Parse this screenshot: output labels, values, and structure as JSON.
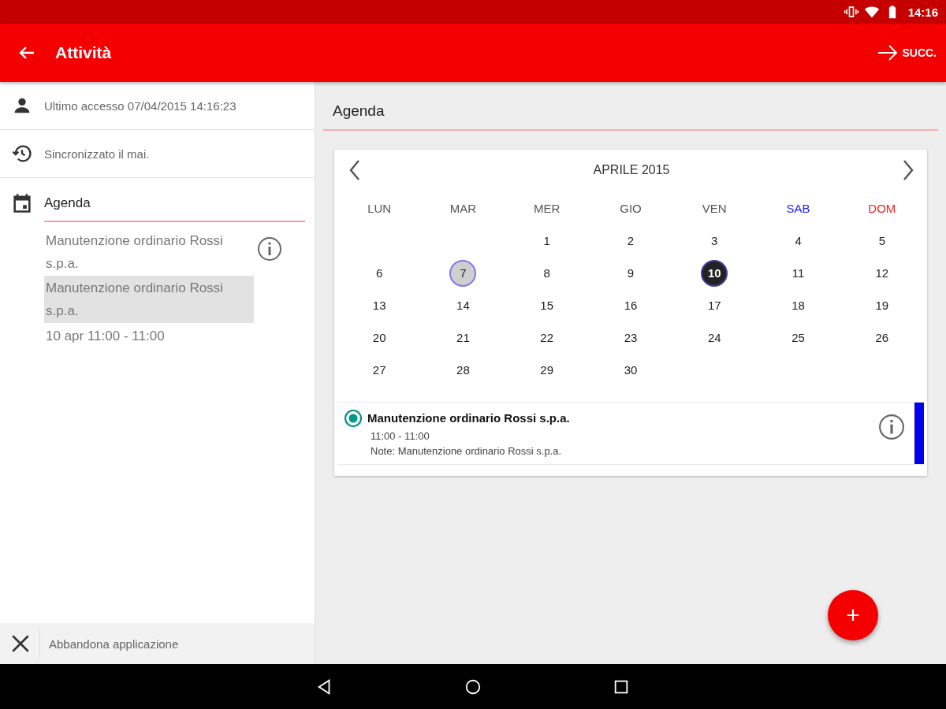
{
  "status_bar": {
    "time": "14:16"
  },
  "app_bar": {
    "title": "Attività",
    "next_label": "SUCC."
  },
  "sidebar": {
    "last_access": "Ultimo accesso 07/04/2015 14:16:23",
    "sync": "Sincronizzato il mai.",
    "agenda_title": "Agenda",
    "events": [
      {
        "title": "Manutenzione ordinario Rossi s.p.a.",
        "selected": false
      },
      {
        "title": "Manutenzione ordinario Rossi s.p.a.",
        "selected": true
      }
    ],
    "event_time": "10 apr 11:00 - 11:00",
    "exit_label": "Abbandona applicazione"
  },
  "main": {
    "title": "Agenda",
    "calendar": {
      "month": "APRILE 2015",
      "weekdays": [
        {
          "label": "LUN",
          "color": "#555555"
        },
        {
          "label": "MAR",
          "color": "#555555"
        },
        {
          "label": "MER",
          "color": "#555555"
        },
        {
          "label": "GIO",
          "color": "#555555"
        },
        {
          "label": "VEN",
          "color": "#555555"
        },
        {
          "label": "SAB",
          "color": "#2222ee"
        },
        {
          "label": "DOM",
          "color": "#ee2222"
        }
      ],
      "weeks": [
        {
          "kind": "partial_start",
          "days": [
            {
              "label": "1",
              "selected": false,
              "today": false
            },
            {
              "label": "2",
              "selected": false,
              "today": false
            },
            {
              "label": "3",
              "selected": false,
              "today": false
            },
            {
              "label": "4",
              "selected": false,
              "today": false
            },
            {
              "label": "5",
              "selected": false,
              "today": false
            }
          ]
        },
        {
          "kind": "full",
          "days": [
            {
              "label": "6",
              "selected": false,
              "today": false
            },
            {
              "label": "7",
              "selected": false,
              "today": true
            },
            {
              "label": "8",
              "selected": false,
              "today": false
            },
            {
              "label": "9",
              "selected": false,
              "today": false
            },
            {
              "label": "10",
              "selected": true,
              "today": false
            },
            {
              "label": "11",
              "selected": false,
              "today": false
            },
            {
              "label": "12",
              "selected": false,
              "today": false
            }
          ]
        },
        {
          "kind": "full",
          "days": [
            {
              "label": "13",
              "selected": false,
              "today": false
            },
            {
              "label": "14",
              "selected": false,
              "today": false
            },
            {
              "label": "15",
              "selected": false,
              "today": false
            },
            {
              "label": "16",
              "selected": false,
              "today": false
            },
            {
              "label": "17",
              "selected": false,
              "today": false
            },
            {
              "label": "18",
              "selected": false,
              "today": false
            },
            {
              "label": "19",
              "selected": false,
              "today": false
            }
          ]
        },
        {
          "kind": "full",
          "days": [
            {
              "label": "20",
              "selected": false,
              "today": false
            },
            {
              "label": "21",
              "selected": false,
              "today": false
            },
            {
              "label": "22",
              "selected": false,
              "today": false
            },
            {
              "label": "23",
              "selected": false,
              "today": false
            },
            {
              "label": "24",
              "selected": false,
              "today": false
            },
            {
              "label": "25",
              "selected": false,
              "today": false
            },
            {
              "label": "26",
              "selected": false,
              "today": false
            }
          ]
        },
        {
          "kind": "partial_end",
          "days": [
            {
              "label": "27",
              "selected": false,
              "today": false
            },
            {
              "label": "28",
              "selected": false,
              "today": false
            },
            {
              "label": "29",
              "selected": false,
              "today": false
            },
            {
              "label": "30",
              "selected": false,
              "today": false
            }
          ]
        }
      ]
    },
    "events": [
      {
        "title": "Manutenzione ordinario Rossi s.p.a.",
        "time": "11:00 - 11:00",
        "note": "Note:  Manutenzione ordinario Rossi s.p.a.",
        "checked": true,
        "color": "#0000ee"
      }
    ],
    "fab": "+"
  }
}
